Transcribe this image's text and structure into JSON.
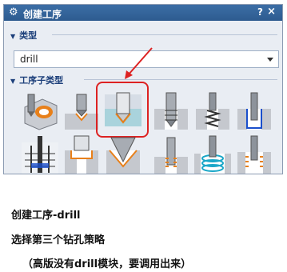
{
  "dialog": {
    "title": "创建工序",
    "help": "?",
    "close": "×",
    "type_section": "类型",
    "type_value": "drill",
    "subtype_section": "工序子类型"
  },
  "caption": {
    "line1": "创建工序-drill",
    "line2": "选择第三个钻孔策略",
    "line3": "（高版没有drill模块，要调用出来）"
  }
}
